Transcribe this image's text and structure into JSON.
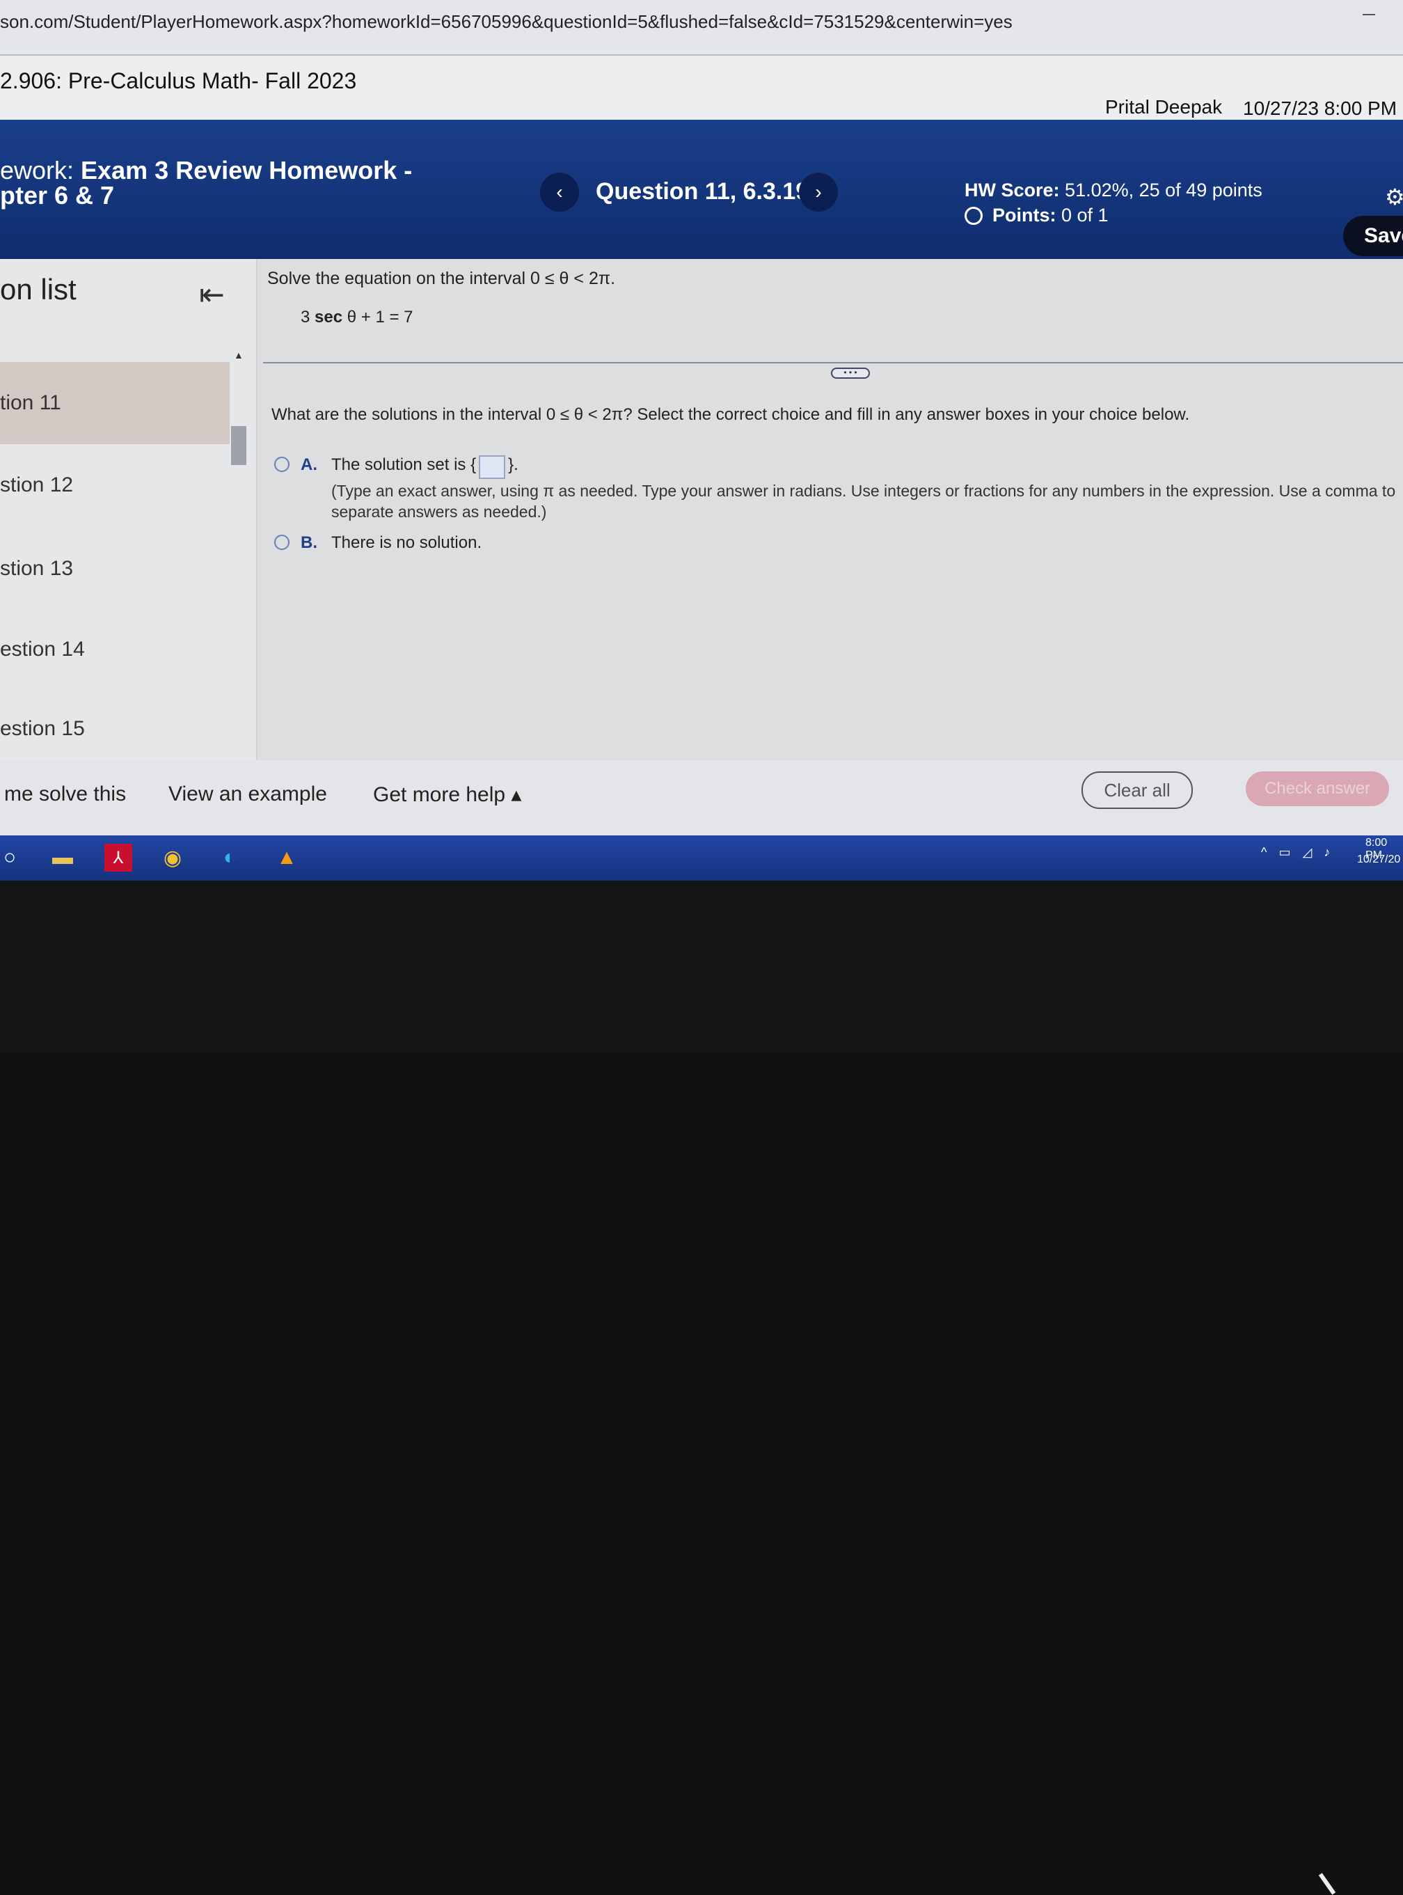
{
  "browser": {
    "url": "son.com/Student/PlayerHomework.aspx?homeworkId=656705996&questionId=5&flushed=false&cId=7531529&centerwin=yes"
  },
  "course_bar": {
    "course": "2.906: Pre-Calculus Math- Fall 2023",
    "user": "Prital Deepak",
    "datetime": "10/27/23 8:00 PM"
  },
  "header": {
    "hw_prefix": "ework:",
    "hw_title_1": "Exam 3 Review Homework -",
    "hw_title_2": "pter 6 & 7",
    "prev_icon": "‹",
    "next_icon": "›",
    "question_title": "Question 11, 6.3.19",
    "hw_score_label": "HW Score:",
    "hw_score_value": "51.02%, 25 of 49 points",
    "points_label": "Points:",
    "points_value": "0 of 1",
    "save_label": "Save"
  },
  "sidebar": {
    "title": "on list",
    "items": [
      {
        "label": "tion 11",
        "active": true
      },
      {
        "label": "stion 12",
        "active": false
      },
      {
        "label": "stion 13",
        "active": false
      },
      {
        "label": "estion 14",
        "active": false
      },
      {
        "label": "estion 15",
        "active": false
      }
    ]
  },
  "question": {
    "prompt": "Solve the equation on the interval 0 ≤ θ < 2π.",
    "equation_coef": "3",
    "equation_fn": "sec",
    "equation_rest": " θ + 1 = 7",
    "ask": "What are the solutions in the interval 0 ≤ θ < 2π?  Select the correct choice and fill in any answer boxes in your choice below.",
    "choice_a_letter": "A.",
    "choice_a_text": "The solution set is",
    "choice_a_open": "{",
    "choice_a_close": "}.",
    "choice_a_hint": "(Type an exact answer, using π as needed.  Type your answer in radians.  Use integers or fractions for any numbers in the expression.  Use a comma to separate answers as needed.)",
    "choice_b_letter": "B.",
    "choice_b_text": "There is no solution."
  },
  "help_bar": {
    "help_me": "me solve this",
    "view_example": "View an example",
    "more_help": "Get more help ▴",
    "clear_all": "Clear all",
    "check_answer": "Check answer"
  },
  "taskbar": {
    "time": "8:00 PM",
    "date": "10/27/20"
  },
  "colors": {
    "header_blue": "#1b3f8a",
    "active_item": "#d3c8c4",
    "check_button": "#d9a8b4"
  }
}
